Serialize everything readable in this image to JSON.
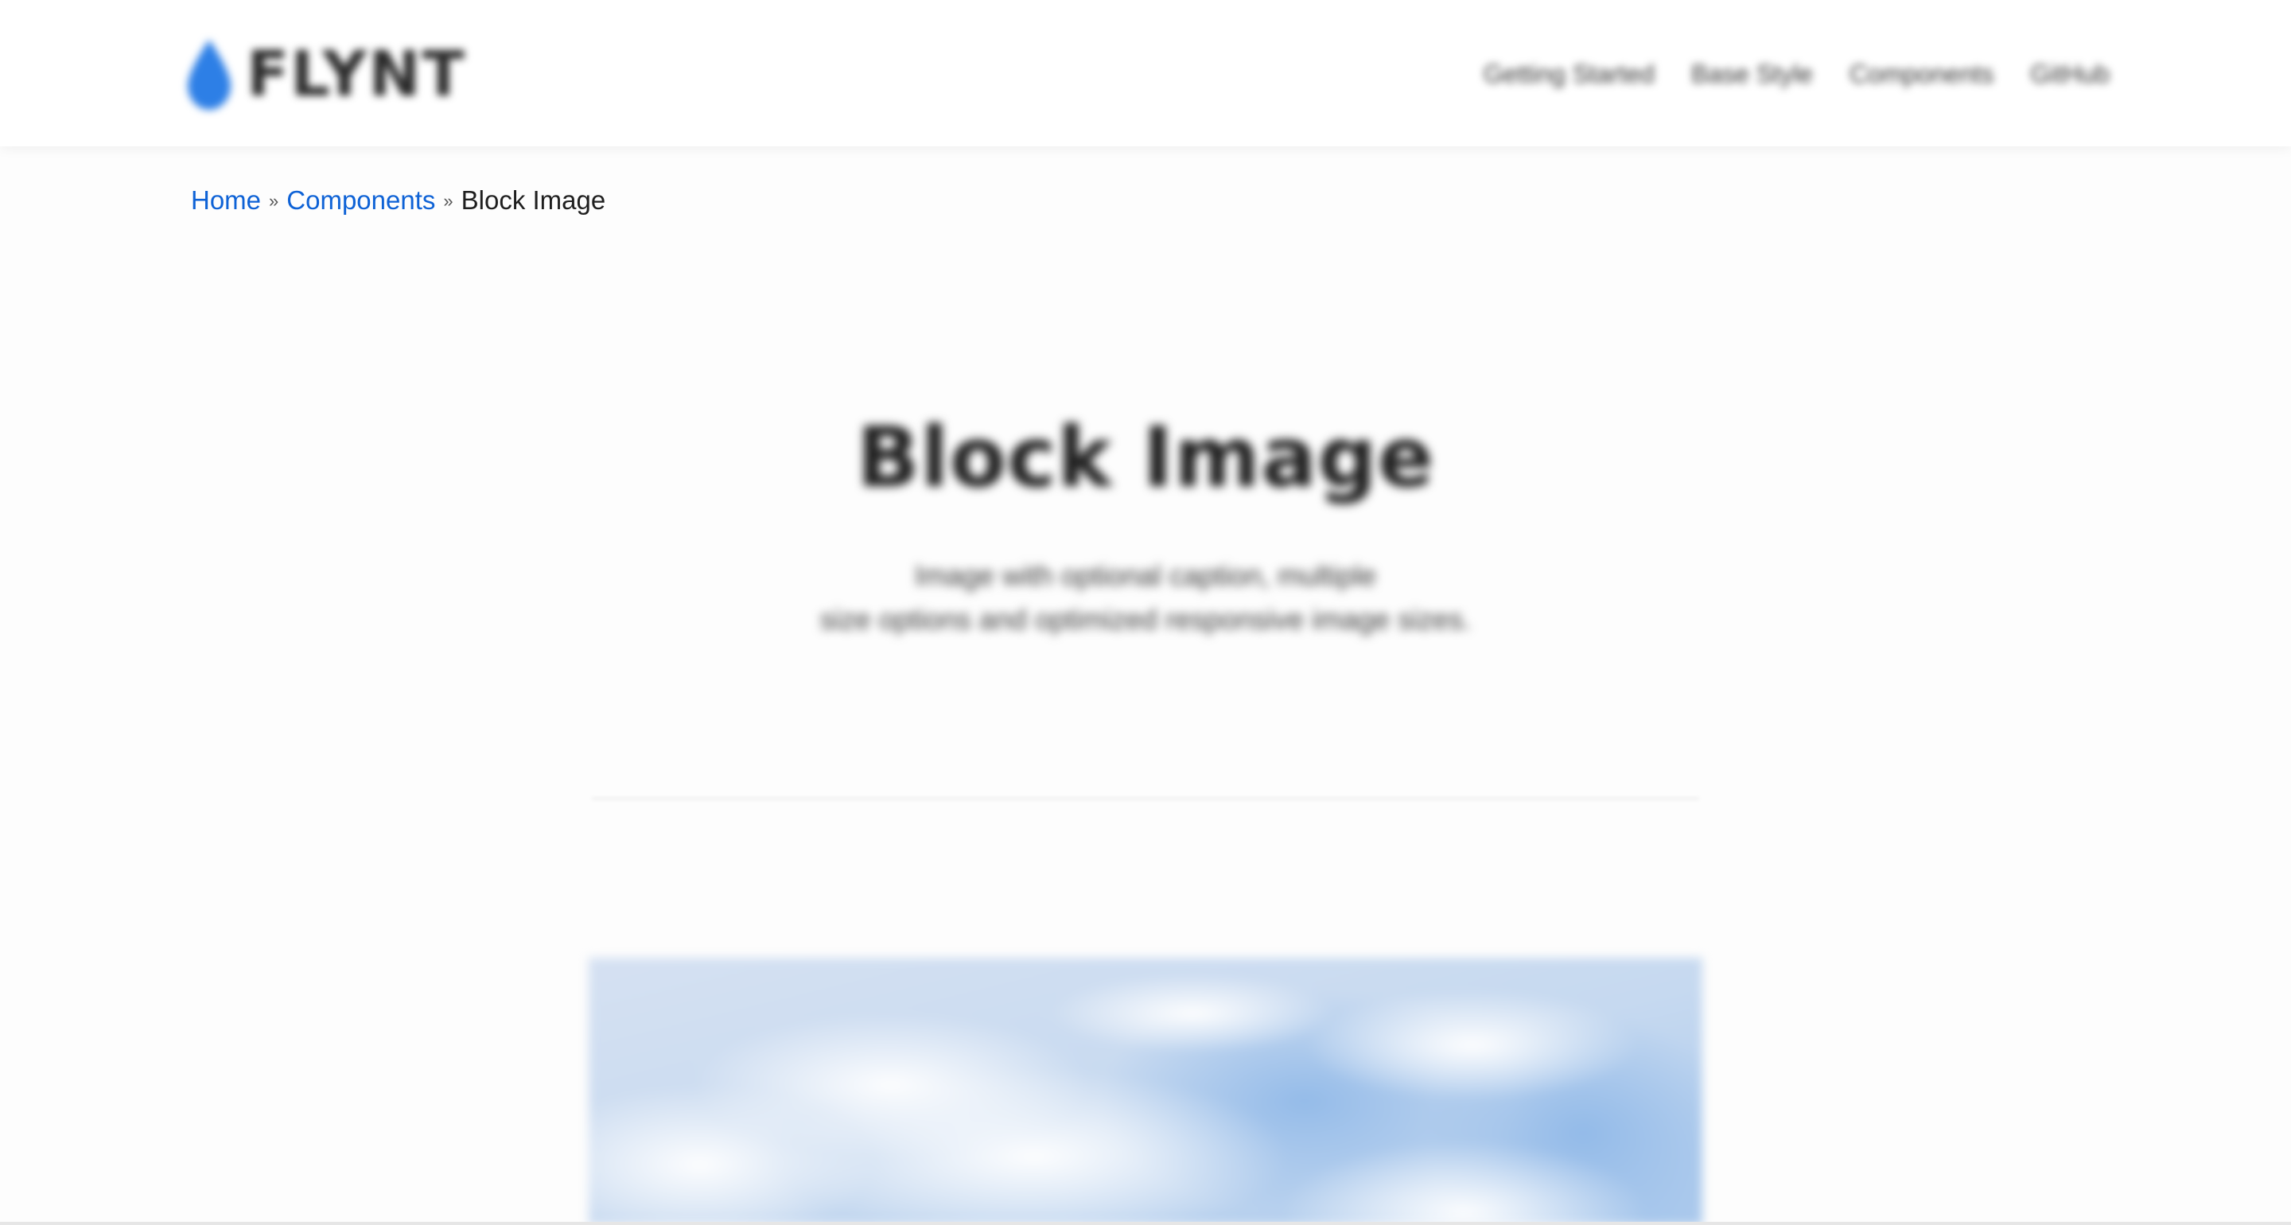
{
  "header": {
    "logo": {
      "icon": "water-drop-icon",
      "text": "FLYNT",
      "accent_color": "#2d7fe6"
    },
    "nav": [
      {
        "label": "Getting Started"
      },
      {
        "label": "Base Style"
      },
      {
        "label": "Components"
      },
      {
        "label": "GitHub"
      }
    ]
  },
  "breadcrumb": {
    "home": "Home",
    "separator_1": "»",
    "components": "Components",
    "separator_2": "»",
    "current": "Block Image",
    "link_color": "#0e62d6"
  },
  "hero": {
    "title": "Block Image",
    "lead_line_1": "Image with optional caption, multiple",
    "lead_line_2": "size options and optimized responsive image sizes."
  },
  "content": {
    "image": {
      "subject": "sky with clouds",
      "dominant_color": "#b9d2f0"
    }
  }
}
